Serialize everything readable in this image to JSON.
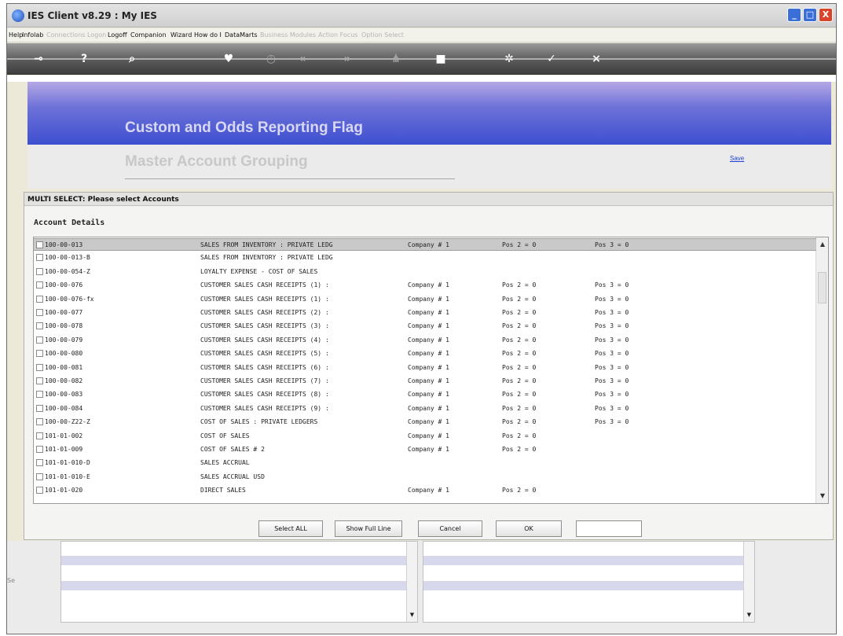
{
  "window": {
    "title": "IES Client v8.29 : My IES",
    "controls": {
      "minimize": "_",
      "maximize": "□",
      "close": "X"
    }
  },
  "menu": [
    {
      "label": "Help",
      "enabled": true
    },
    {
      "label": "Infolab",
      "enabled": true
    },
    {
      "label": "Connections",
      "enabled": false
    },
    {
      "label": "Logon",
      "enabled": false
    },
    {
      "label": "Logoff",
      "enabled": true
    },
    {
      "label": "Companion",
      "enabled": true
    },
    {
      "label": "Wizard",
      "enabled": true
    },
    {
      "label": "How do I",
      "enabled": true
    },
    {
      "label": "DataMarts",
      "enabled": true
    },
    {
      "label": "Business Modules",
      "enabled": false
    },
    {
      "label": "Action Focus",
      "enabled": false
    },
    {
      "label": "Option Select",
      "enabled": false
    }
  ],
  "toolbar": [
    {
      "name": "back-key-icon",
      "glyph": "⊸",
      "enabled": true
    },
    {
      "name": "help-icon",
      "glyph": "?",
      "enabled": true
    },
    {
      "name": "search-icon",
      "glyph": "⌕",
      "enabled": true
    },
    {
      "name": "heart-icon",
      "glyph": "♥",
      "enabled": true
    },
    {
      "name": "clock-icon",
      "glyph": "◷",
      "enabled": false
    },
    {
      "name": "rewind-icon",
      "glyph": "«",
      "enabled": false
    },
    {
      "name": "forward-icon",
      "glyph": "»",
      "enabled": false
    },
    {
      "name": "tree-icon",
      "glyph": "⋔",
      "enabled": false
    },
    {
      "name": "stop-icon",
      "glyph": "■",
      "enabled": true
    },
    {
      "name": "settings-icon",
      "glyph": "✲",
      "enabled": true
    },
    {
      "name": "check-icon",
      "glyph": "✓",
      "enabled": true
    },
    {
      "name": "close-icon",
      "glyph": "×",
      "enabled": true
    }
  ],
  "header": {
    "title": "Custom and Odds Reporting Flag",
    "subtitle": "Master Account Grouping",
    "save_label": "Save"
  },
  "dialog": {
    "title": "MULTI SELECT: Please select Accounts",
    "section": "Account Details",
    "rows": [
      {
        "code": "100-00-013",
        "desc": "SALES FROM INVENTORY : PRIVATE LEDG",
        "comp": "Company # 1",
        "pos2": "Pos 2 = 0",
        "pos3": "Pos 3 = 0",
        "selected": true
      },
      {
        "code": "100-00-013-B",
        "desc": "SALES FROM INVENTORY : PRIVATE LEDG",
        "comp": "",
        "pos2": "",
        "pos3": "",
        "selected": false
      },
      {
        "code": "100-00-054-Z",
        "desc": "LOYALTY EXPENSE - COST OF SALES",
        "comp": "",
        "pos2": "",
        "pos3": "",
        "selected": false
      },
      {
        "code": "100-00-076",
        "desc": "CUSTOMER SALES CASH RECEIPTS (1) :",
        "comp": "Company # 1",
        "pos2": "Pos 2 = 0",
        "pos3": "Pos 3 = 0",
        "selected": false
      },
      {
        "code": "100-00-076-fx",
        "desc": "CUSTOMER SALES CASH RECEIPTS (1) :",
        "comp": "Company # 1",
        "pos2": "Pos 2 = 0",
        "pos3": "Pos 3 = 0",
        "selected": false
      },
      {
        "code": "100-00-077",
        "desc": "CUSTOMER SALES CASH RECEIPTS (2) :",
        "comp": "Company # 1",
        "pos2": "Pos 2 = 0",
        "pos3": "Pos 3 = 0",
        "selected": false
      },
      {
        "code": "100-00-078",
        "desc": "CUSTOMER SALES CASH RECEIPTS (3) :",
        "comp": "Company # 1",
        "pos2": "Pos 2 = 0",
        "pos3": "Pos 3 = 0",
        "selected": false
      },
      {
        "code": "100-00-079",
        "desc": "CUSTOMER SALES CASH RECEIPTS (4) :",
        "comp": "Company # 1",
        "pos2": "Pos 2 = 0",
        "pos3": "Pos 3 = 0",
        "selected": false
      },
      {
        "code": "100-00-080",
        "desc": "CUSTOMER SALES CASH RECEIPTS (5) :",
        "comp": "Company # 1",
        "pos2": "Pos 2 = 0",
        "pos3": "Pos 3 = 0",
        "selected": false
      },
      {
        "code": "100-00-081",
        "desc": "CUSTOMER SALES CASH RECEIPTS (6) :",
        "comp": "Company # 1",
        "pos2": "Pos 2 = 0",
        "pos3": "Pos 3 = 0",
        "selected": false
      },
      {
        "code": "100-00-082",
        "desc": "CUSTOMER SALES CASH RECEIPTS (7) :",
        "comp": "Company # 1",
        "pos2": "Pos 2 = 0",
        "pos3": "Pos 3 = 0",
        "selected": false
      },
      {
        "code": "100-00-083",
        "desc": "CUSTOMER SALES CASH RECEIPTS (8) :",
        "comp": "Company # 1",
        "pos2": "Pos 2 = 0",
        "pos3": "Pos 3 = 0",
        "selected": false
      },
      {
        "code": "100-00-084",
        "desc": "CUSTOMER SALES CASH RECEIPTS (9) :",
        "comp": "Company # 1",
        "pos2": "Pos 2 = 0",
        "pos3": "Pos 3 = 0",
        "selected": false
      },
      {
        "code": "100-00-Z22-Z",
        "desc": "COST OF SALES : PRIVATE LEDGERS",
        "comp": "Company # 1",
        "pos2": "Pos 2 = 0",
        "pos3": "Pos 3 = 0",
        "selected": false
      },
      {
        "code": "101-01-002",
        "desc": "COST OF SALES",
        "comp": "Company # 1",
        "pos2": "Pos 2 = 0",
        "pos3": "",
        "selected": false
      },
      {
        "code": "101-01-009",
        "desc": "COST OF SALES # 2",
        "comp": "Company # 1",
        "pos2": "Pos 2 = 0",
        "pos3": "",
        "selected": false
      },
      {
        "code": "101-01-010-D",
        "desc": "SALES ACCRUAL",
        "comp": "",
        "pos2": "",
        "pos3": "",
        "selected": false
      },
      {
        "code": "101-01-010-E",
        "desc": "SALES ACCRUAL USD",
        "comp": "",
        "pos2": "",
        "pos3": "",
        "selected": false
      },
      {
        "code": "101-01-020",
        "desc": "DIRECT SALES",
        "comp": "Company # 1",
        "pos2": "Pos 2 = 0",
        "pos3": "",
        "selected": false
      }
    ],
    "buttons": {
      "select_all": "Select ALL",
      "show_full_line": "Show Full Line",
      "cancel": "Cancel",
      "ok": "OK"
    },
    "input_value": ""
  },
  "bottom": {
    "left_stub": "Se"
  }
}
